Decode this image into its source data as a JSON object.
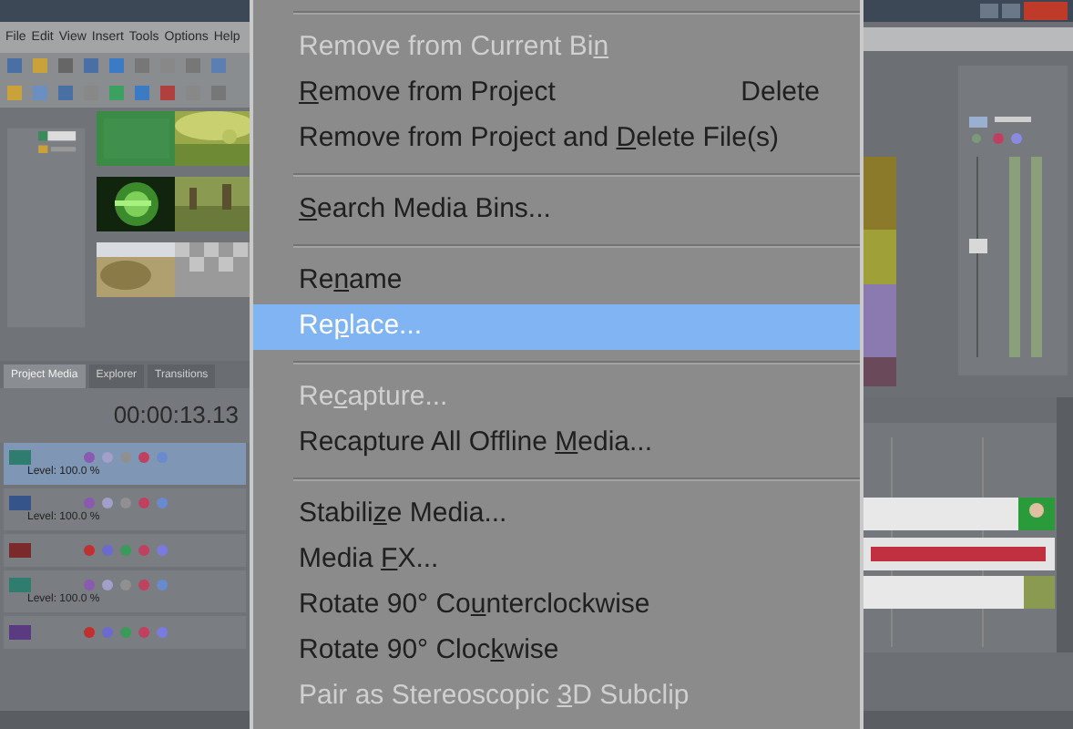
{
  "background_app": {
    "menu_bar": [
      "File",
      "Edit",
      "View",
      "Insert",
      "Tools",
      "Options",
      "Help"
    ],
    "tabs": [
      {
        "label": "Project Media",
        "selected": true
      },
      {
        "label": "Explorer",
        "selected": false
      },
      {
        "label": "Transitions",
        "selected": false
      }
    ],
    "timecode": "00:00:13.13",
    "tracks": [
      {
        "kind": "video",
        "color": "#2e7d6e",
        "selected": true,
        "level_text": "Level: 100.0 %"
      },
      {
        "kind": "video",
        "color": "#35558a",
        "selected": false,
        "level_text": "Level: 100.0 %"
      },
      {
        "kind": "audio",
        "color": "#7a2a2a",
        "selected": false
      },
      {
        "kind": "video",
        "color": "#2e7d6e",
        "selected": false,
        "level_text": "Level: 100.0 %"
      },
      {
        "kind": "audio",
        "color": "#5a3a80",
        "selected": false
      }
    ]
  },
  "context_menu": {
    "items": [
      {
        "kind": "separator"
      },
      {
        "kind": "item",
        "label_parts": {
          "before": "Remove from Current Bi",
          "key": "n"
        },
        "disabled": true,
        "selected": false
      },
      {
        "kind": "item",
        "label_parts": {
          "key": "R",
          "after": "emove from Project"
        },
        "shortcut": "Delete",
        "disabled": false,
        "selected": false
      },
      {
        "kind": "item",
        "label_parts": {
          "before": "Remove from Project and ",
          "key": "D",
          "after": "elete File(s)"
        },
        "disabled": false,
        "selected": false
      },
      {
        "kind": "separator"
      },
      {
        "kind": "item",
        "label_parts": {
          "key": "S",
          "after": "earch Media Bins..."
        },
        "disabled": false,
        "selected": false
      },
      {
        "kind": "separator"
      },
      {
        "kind": "item",
        "label_parts": {
          "before": "Re",
          "key": "n",
          "after": "ame"
        },
        "disabled": false,
        "selected": false
      },
      {
        "kind": "item",
        "label_parts": {
          "before": "Re",
          "key": "p",
          "after": "lace..."
        },
        "disabled": false,
        "selected": true
      },
      {
        "kind": "separator"
      },
      {
        "kind": "item",
        "label_parts": {
          "before": "Re",
          "key": "c",
          "after": "apture..."
        },
        "disabled": true,
        "selected": false
      },
      {
        "kind": "item",
        "label_parts": {
          "before": "Recapture All Offline ",
          "key": "M",
          "after": "edia..."
        },
        "disabled": false,
        "selected": false
      },
      {
        "kind": "separator"
      },
      {
        "kind": "item",
        "label_parts": {
          "before": "Stabili",
          "key": "z",
          "after": "e Media..."
        },
        "disabled": false,
        "selected": false
      },
      {
        "kind": "item",
        "label_parts": {
          "before": "Media ",
          "key": "F",
          "after": "X..."
        },
        "disabled": false,
        "selected": false
      },
      {
        "kind": "item",
        "label_parts": {
          "before": "Rotate 90° Co",
          "key": "u",
          "after": "nterclockwise"
        },
        "disabled": false,
        "selected": false
      },
      {
        "kind": "item",
        "label_parts": {
          "before": "Rotate 90° Cloc",
          "key": "k",
          "after": "wise"
        },
        "disabled": false,
        "selected": false
      },
      {
        "kind": "item",
        "label_parts": {
          "before": "Pair as Stereoscopic ",
          "key": "3",
          "after": "D Subclip"
        },
        "disabled": true,
        "selected": false
      }
    ]
  }
}
